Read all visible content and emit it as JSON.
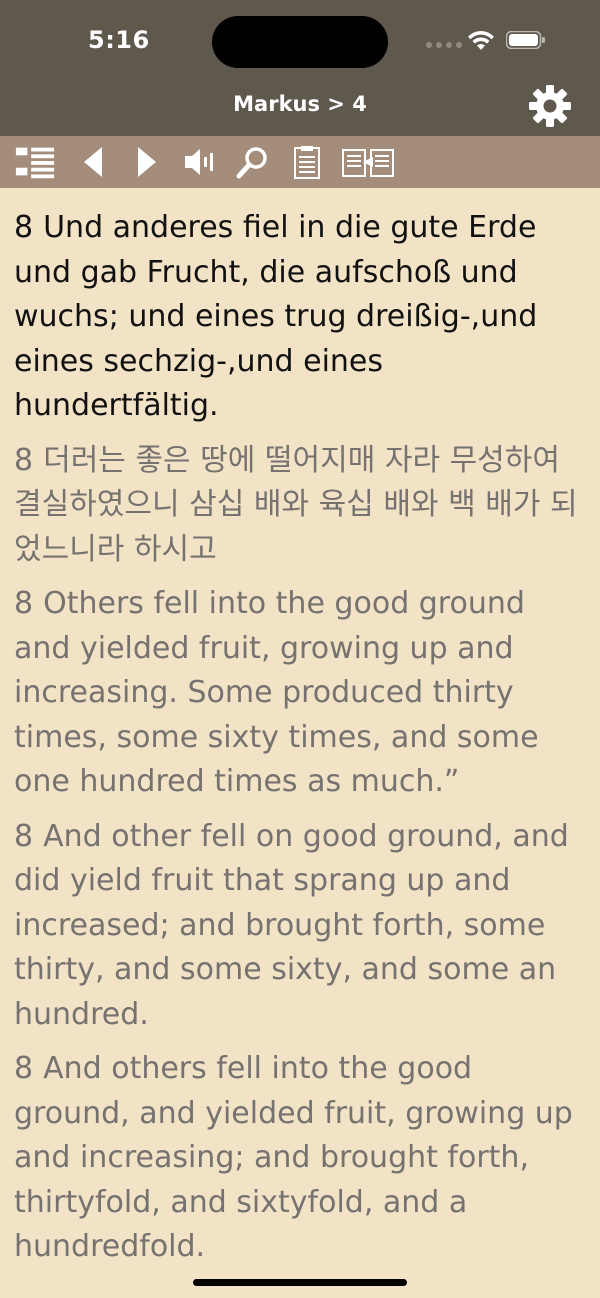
{
  "status_bar": {
    "time": "5:16"
  },
  "nav": {
    "title": "Markus > 4"
  },
  "toolbar": {
    "buttons": [
      {
        "name": "list-icon"
      },
      {
        "name": "previous-icon"
      },
      {
        "name": "next-icon"
      },
      {
        "name": "speaker-icon"
      },
      {
        "name": "search-icon"
      },
      {
        "name": "notes-icon"
      },
      {
        "name": "compare-icon"
      }
    ]
  },
  "verses": [
    {
      "num": "8",
      "text": "Und anderes fiel in die gute Erde und gab Frucht, die aufschoß und wuchs; und eines trug dreißig-,und eines sechzig-,und eines hundertfältig."
    },
    {
      "num": "8",
      "text": "더러는 좋은 땅에 떨어지매 자라 무성하여 결실하였으니 삼십 배와 육십 배와 백 배가 되었느니라 하시고"
    },
    {
      "num": "8",
      "text": "Others fell into the good ground and yielded fruit, growing up and increasing. Some produced thirty times, some sixty times, and some one hundred times as much.”"
    },
    {
      "num": "8",
      "text": "And other fell on good ground, and did yield fruit that sprang up and increased; and brought forth, some thirty, and some sixty, and some an hundred."
    },
    {
      "num": "8",
      "text": "And others fell into the good ground, and yielded fruit, growing up and increasing; and brought forth, thirtyfold, and sixtyfold, and a hundredfold."
    }
  ],
  "colors": {
    "background": "#f3e3c6",
    "topbar": "#5f584d",
    "toolbar": "#a58d7b",
    "primary_text": "#111111",
    "secondary_text": "#757270"
  }
}
